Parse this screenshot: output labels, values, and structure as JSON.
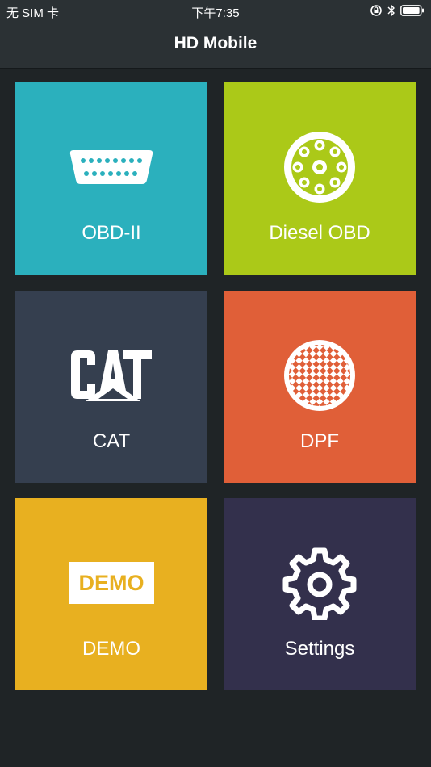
{
  "status_bar": {
    "carrier": "无 SIM 卡",
    "time": "下午7:35",
    "icons": [
      "orientation-lock-icon",
      "bluetooth-icon",
      "battery-icon"
    ]
  },
  "nav": {
    "title": "HD Mobile"
  },
  "colors": {
    "background": "#1f2426",
    "nav_bar": "#2b3134",
    "obd2": "#2bb0bd",
    "diesel_obd": "#abc918",
    "cat": "#353f4f",
    "dpf": "#e05f38",
    "demo": "#e8b020",
    "settings": "#33304c"
  },
  "tiles": [
    {
      "label": "OBD-II",
      "icon": "obd-connector-icon"
    },
    {
      "label": "Diesel OBD",
      "icon": "round-connector-icon"
    },
    {
      "label": "CAT",
      "icon": "cat-logo-icon"
    },
    {
      "label": "DPF",
      "icon": "dpf-filter-icon"
    },
    {
      "label": "DEMO",
      "icon": "demo-badge-icon",
      "badge_text": "DEMO"
    },
    {
      "label": "Settings",
      "icon": "gear-icon"
    }
  ]
}
